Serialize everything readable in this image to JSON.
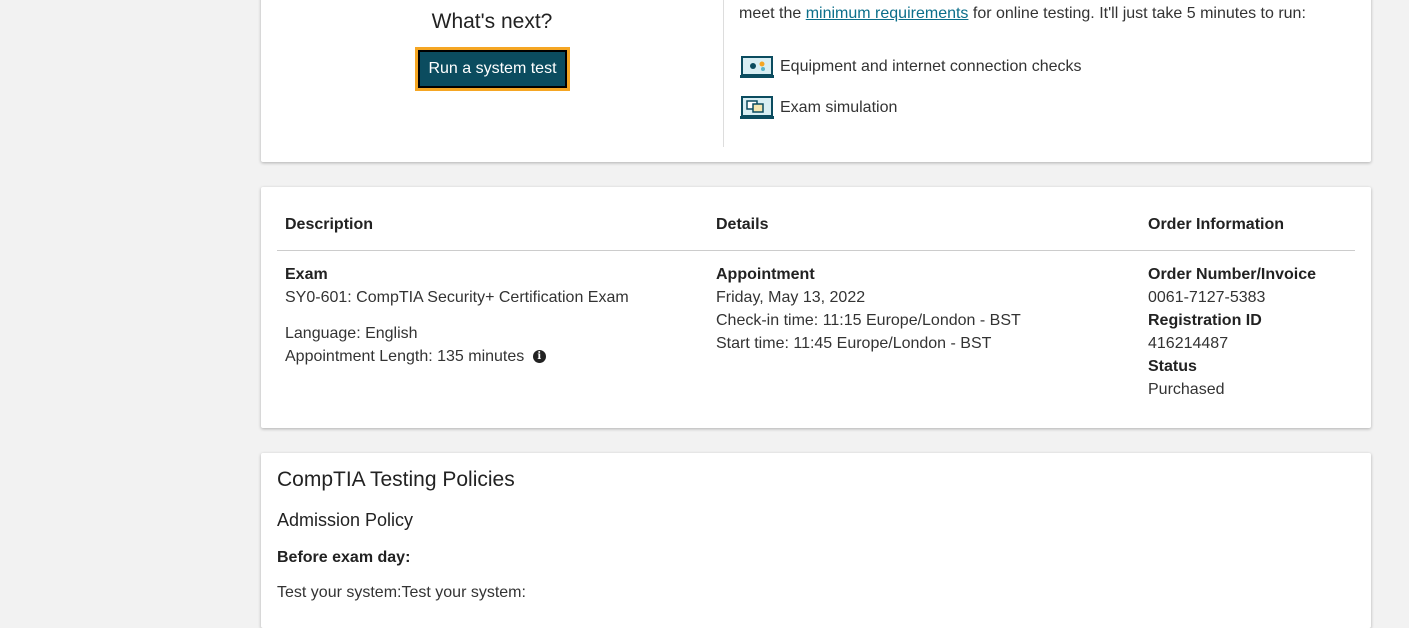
{
  "top": {
    "whats_next": "What's next?",
    "run_button": "Run a system test",
    "req_prefix": "meet the",
    "req_link": "minimum requirements",
    "req_suffix": "for online testing. It'll just take 5 minutes to run:",
    "checks": [
      {
        "label": "Equipment and internet connection checks",
        "icon": "equipment-check-icon"
      },
      {
        "label": "Exam simulation",
        "icon": "exam-simulation-icon"
      }
    ]
  },
  "order": {
    "headers": {
      "description": "Description",
      "details": "Details",
      "order_info": "Order Information"
    },
    "description": {
      "label": "Exam",
      "exam": "SY0-601: CompTIA Security+ Certification Exam",
      "language": "Language: English",
      "length": "Appointment Length: 135 minutes"
    },
    "details": {
      "label": "Appointment",
      "date": "Friday, May 13, 2022",
      "checkin": "Check-in time: 11:15 Europe/London - BST",
      "start": "Start time: 11:45 Europe/London - BST"
    },
    "order_info": {
      "order_label": "Order Number/Invoice",
      "order_value": "0061-7127-5383",
      "reg_label": "Registration ID",
      "reg_value": "416214487",
      "status_label": "Status",
      "status_value": "Purchased"
    }
  },
  "policies": {
    "title": "CompTIA Testing Policies",
    "subtitle": "Admission Policy",
    "before": "Before exam day:",
    "test_system": "Test your system:Test your system:"
  },
  "colors": {
    "button_bg": "#0b4c5f",
    "button_border": "#f5a623",
    "link": "#0a6e8a"
  }
}
